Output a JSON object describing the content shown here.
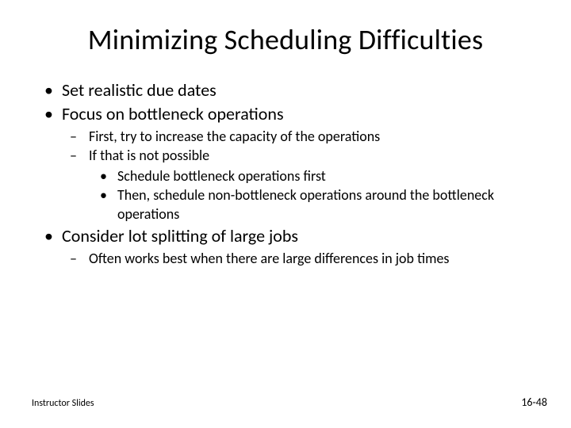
{
  "title": "Minimizing Scheduling Difficulties",
  "bullets": {
    "b1": "Set realistic due dates",
    "b2": "Focus on bottleneck operations",
    "b2_1": "First, try to increase the capacity of the operations",
    "b2_2": "If that is not possible",
    "b2_2_1": "Schedule bottleneck operations first",
    "b2_2_2": "Then, schedule non-bottleneck operations around the bottleneck operations",
    "b3": "Consider lot splitting of large jobs",
    "b3_1": "Often works best when there are large differences in job times"
  },
  "footer": {
    "left": "Instructor Slides",
    "right": "16-48"
  }
}
